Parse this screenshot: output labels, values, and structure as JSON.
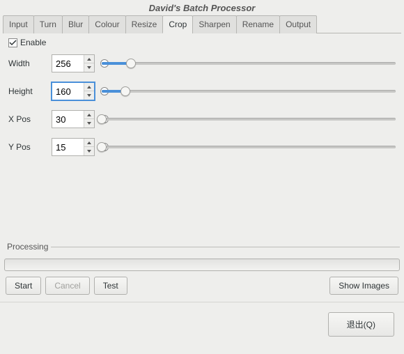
{
  "title": "David's Batch Processor",
  "tabs": [
    "Input",
    "Turn",
    "Blur",
    "Colour",
    "Resize",
    "Crop",
    "Sharpen",
    "Rename",
    "Output"
  ],
  "active_tab": "Crop",
  "enable": {
    "label": "Enable",
    "checked": true
  },
  "fields": {
    "width": {
      "label": "Width",
      "value": "256",
      "slider_pct": 10,
      "focused": false
    },
    "height": {
      "label": "Height",
      "value": "160",
      "slider_pct": 8,
      "focused": true
    },
    "xpos": {
      "label": "X Pos",
      "value": "30",
      "slider_pct": 0,
      "focused": false
    },
    "ypos": {
      "label": "Y Pos",
      "value": "15",
      "slider_pct": 0,
      "focused": false
    }
  },
  "processing_label": "Processing",
  "buttons": {
    "start": "Start",
    "cancel": "Cancel",
    "test": "Test",
    "show_images": "Show Images",
    "quit": "退出(Q)"
  }
}
